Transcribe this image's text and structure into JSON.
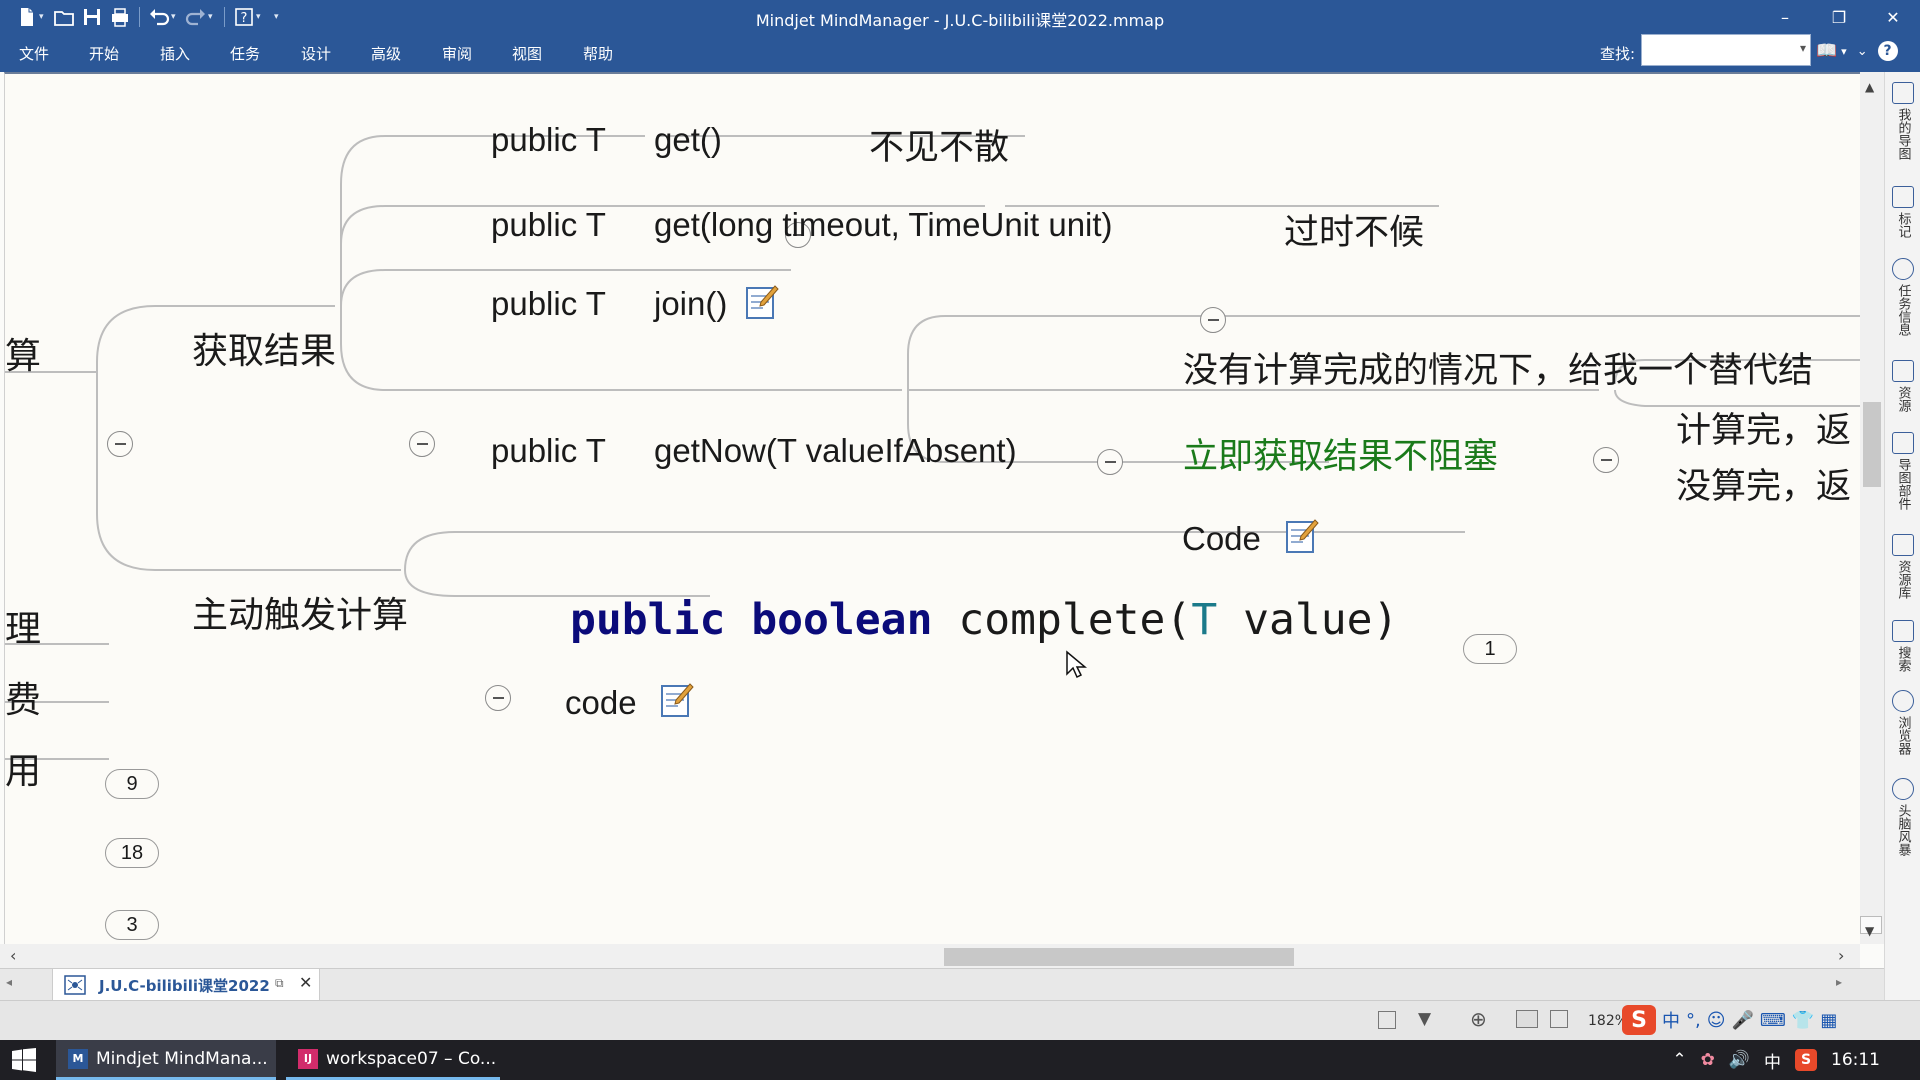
{
  "window": {
    "title": "Mindjet MindManager - J.U.C-bilibili课堂2022.mmap",
    "minimize": "–",
    "maximize": "❐",
    "close": "✕"
  },
  "menu": {
    "items": [
      "文件",
      "开始",
      "插入",
      "任务",
      "设计",
      "高级",
      "审阅",
      "视图",
      "帮助"
    ],
    "find_label": "查找:",
    "find_value": ""
  },
  "map": {
    "left_cut_1": "算",
    "branch_get_result": "获取结果",
    "get_prefix": "public T",
    "get_method": "get()",
    "get_note": "不见不散",
    "get_timeout_prefix": "public T",
    "get_timeout_method": "get(long timeout, TimeUnit unit)",
    "get_timeout_note": "过时不候",
    "join_prefix": "public T",
    "join_method": "join()",
    "getnow_prefix": "public T",
    "getnow_method": "getNow(T valueIfAbsent)",
    "getnow_child_1": "没有计算完成的情况下，给我一个替代结",
    "getnow_child_2": "立即获取结果不阻塞",
    "getnow_child_2_sub_1": "计算完，返",
    "getnow_child_2_sub_2": "没算完，返",
    "getnow_child_3": "Code",
    "branch_complete": "主动触发计算",
    "complete_kw1": "public",
    "complete_kw2": "boolean",
    "complete_name": "complete(",
    "complete_type": "T",
    "complete_rest": " value)",
    "complete_badge": "1",
    "complete_code": "code",
    "left_cut_2": "理",
    "left_cut_2_badge": "9",
    "left_cut_3": "费",
    "left_cut_3_badge": "18",
    "left_cut_4": "用",
    "left_cut_4_badge": "3"
  },
  "side_panel": [
    "我的导图",
    "标记",
    "任务信息",
    "资源",
    "导图部件",
    "资源库",
    "搜索",
    "浏览器",
    "头脑风暴"
  ],
  "doc_tab": {
    "label": "J.U.C-bilibili课堂2022"
  },
  "status": {
    "zoom": "182%",
    "ime": "中"
  },
  "taskbar": {
    "app1": "Mindjet MindMana...",
    "app2": "workspace07 – Co...",
    "ime": "中",
    "time": "16:11"
  },
  "colors": {
    "accent": "#2b5797",
    "keyword": "#0b0b7a",
    "type": "#1b7a8a",
    "green": "#1a7a1a"
  }
}
